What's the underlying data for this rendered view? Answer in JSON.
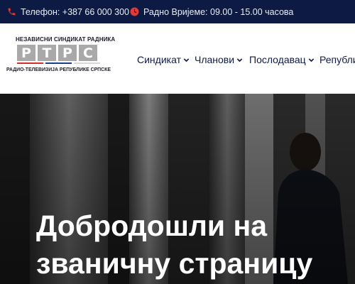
{
  "topbar": {
    "phone_icon": "phone-icon",
    "phone_text": "Телефон: +387 66 000 300",
    "clock_icon": "clock-icon",
    "hours_text": "Радно Вријеме: 09.00 - 15.00 часова"
  },
  "logo": {
    "top_text": "НЕЗАВИСНИ СИНДИКАТ РАДНИКА",
    "letters": [
      "Р",
      "Т",
      "Р",
      "С"
    ],
    "bottom_text": "РАДИО-ТЕЛЕВИЗИЈА РЕПУБЛИКЕ СРПСКЕ",
    "stripe_colors": [
      "#d32f2f",
      "#1e3c8f",
      "#d9d9d9"
    ]
  },
  "nav": {
    "items": [
      {
        "label": "Синдикат"
      },
      {
        "label": "Чланови"
      },
      {
        "label": "Послодавац"
      },
      {
        "label": "Републи"
      }
    ]
  },
  "hero": {
    "title_line1": "Добродошли на",
    "title_line2": "званичну страницу"
  },
  "colors": {
    "topbar_bg": "#0d1a44",
    "accent_red": "#d32f2f",
    "nav_text": "#0d1a44"
  }
}
